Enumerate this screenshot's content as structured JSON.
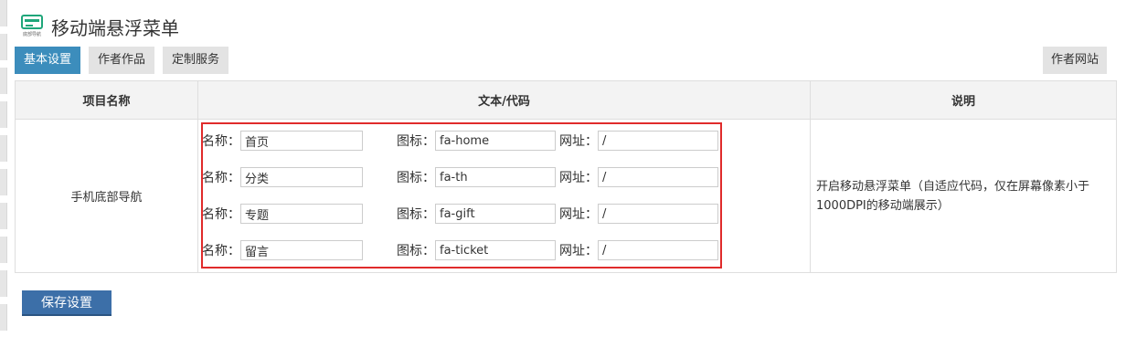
{
  "page": {
    "title": "移动端悬浮菜单",
    "logo_caption": "底部导航"
  },
  "tabs": [
    {
      "label": "基本设置",
      "active": true
    },
    {
      "label": "作者作品",
      "active": false
    },
    {
      "label": "定制服务",
      "active": false
    }
  ],
  "author_site_label": "作者网站",
  "table": {
    "headers": [
      "项目名称",
      "文本/代码",
      "说明"
    ],
    "row_name": "手机底部导航",
    "description": "开启移动悬浮菜单（自适应代码，仅在屏幕像素小于1000DPI的移动端展示）",
    "labels": {
      "name": "名称：",
      "icon": "图标：",
      "url": "网址："
    },
    "items": [
      {
        "name": "首页",
        "icon": "fa-home",
        "url": "/"
      },
      {
        "name": "分类",
        "icon": "fa-th",
        "url": "/"
      },
      {
        "name": "专题",
        "icon": "fa-gift",
        "url": "/"
      },
      {
        "name": "留言",
        "icon": "fa-ticket",
        "url": "/"
      }
    ]
  },
  "save_label": "保存设置",
  "colors": {
    "accent": "#3c8dbc",
    "save_button": "#3c6fa8",
    "highlight_border": "#e02b2b",
    "logo": "#1fa67a"
  }
}
